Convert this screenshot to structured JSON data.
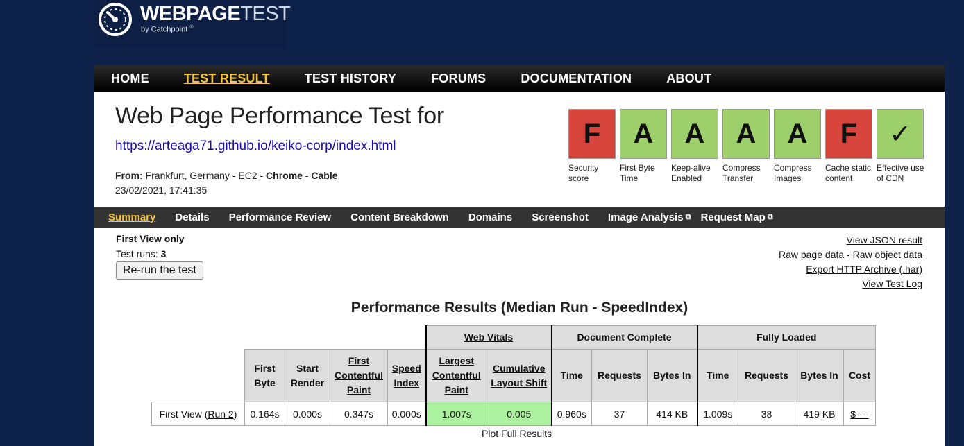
{
  "logo": {
    "word_bold": "WEBPAGE",
    "word_thin": "TEST",
    "sub": "by Catchpoint",
    "reg": "®"
  },
  "nav": {
    "items": [
      "HOME",
      "TEST RESULT",
      "TEST HISTORY",
      "FORUMS",
      "DOCUMENTATION",
      "ABOUT"
    ],
    "active": "TEST RESULT"
  },
  "header": {
    "title": "Web Page Performance Test for",
    "url": "https://arteaga71.github.io/keiko-corp/index.html",
    "from_label": "From:",
    "from_location": "Frankfurt, Germany - EC2 - ",
    "browser": "Chrome",
    "sep": " - ",
    "connection": "Cable",
    "date": "23/02/2021, 17:41:35"
  },
  "grades": [
    {
      "grade": "F",
      "label": "Security score",
      "status": "fail"
    },
    {
      "grade": "A",
      "label": "First Byte Time",
      "status": "pass"
    },
    {
      "grade": "A",
      "label": "Keep-alive Enabled",
      "status": "pass"
    },
    {
      "grade": "A",
      "label": "Compress Transfer",
      "status": "pass"
    },
    {
      "grade": "A",
      "label": "Compress Images",
      "status": "pass"
    },
    {
      "grade": "F",
      "label": "Cache static content",
      "status": "fail"
    },
    {
      "grade": "✓",
      "label": "Effective use of CDN",
      "status": "pass"
    }
  ],
  "colors": {
    "fail": "#d8453c",
    "pass": "#9dd06a",
    "accent": "#f5c23e",
    "good_vital": "#adf2a0"
  },
  "subnav": {
    "items": [
      "Summary",
      "Details",
      "Performance Review",
      "Content Breakdown",
      "Domains",
      "Screenshot",
      "Image Analysis",
      "Request Map"
    ],
    "active": "Summary"
  },
  "summary": {
    "first_view_only": "First View only",
    "runs_label": "Test runs: ",
    "runs_value": "3",
    "rerun_button": "Re-run the test"
  },
  "links": {
    "json": "View JSON result",
    "raw_page": "Raw page data",
    "dash": " - ",
    "raw_object": "Raw object data",
    "har": "Export HTTP Archive (.har)",
    "log": "View Test Log"
  },
  "results": {
    "heading": "Performance Results (Median Run - SpeedIndex)",
    "groups": {
      "web_vitals": "Web Vitals",
      "document_complete": "Document Complete",
      "fully_loaded": "Fully Loaded"
    },
    "columns": {
      "first_byte": "First Byte",
      "start_render": "Start Render",
      "fcp": "First Contentful Paint",
      "speed_index": "Speed Index",
      "lcp": "Largest Contentful Paint",
      "cls": "Cumulative Layout Shift",
      "time": "Time",
      "requests": "Requests",
      "bytes_in": "Bytes In",
      "cost": "Cost"
    },
    "row": {
      "label": "First View (",
      "run_link": "Run 2",
      "label_end": ")",
      "first_byte": "0.164s",
      "start_render": "0.000s",
      "fcp": "0.347s",
      "speed_index": "0.000s",
      "lcp": "1.007s",
      "cls": "0.005",
      "dc_time": "0.960s",
      "dc_requests": "37",
      "dc_bytes": "414 KB",
      "fl_time": "1.009s",
      "fl_requests": "38",
      "fl_bytes": "419 KB",
      "cost": "$----"
    },
    "plot_link": "Plot Full Results"
  }
}
